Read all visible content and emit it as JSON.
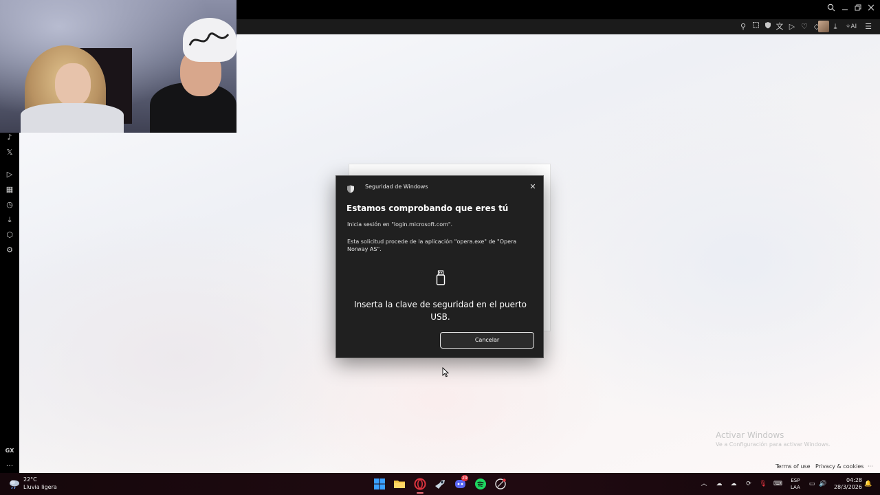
{
  "browser": {
    "ai_label": "AI"
  },
  "sidebar": {
    "gx_label": "GX",
    "more_label": "···"
  },
  "dialog": {
    "app_name": "Seguridad de Windows",
    "close_glyph": "✕",
    "title": "Estamos comprobando que eres tú",
    "signin_line": "Inicia sesión en \"login.microsoft.com\".",
    "request_line": "Esta solicitud procede de la aplicación \"opera.exe\" de \"Opera Norway AS\".",
    "prompt": "Inserta la clave de seguridad en el puerto USB.",
    "cancel_label": "Cancelar"
  },
  "watermark": {
    "title": "Activar Windows",
    "subtitle": "Ve a Configuración para activar Windows."
  },
  "footer": {
    "terms": "Terms of use",
    "privacy": "Privacy & cookies",
    "more": "···"
  },
  "taskbar": {
    "temperature": "22°C",
    "weather": "Lluvia ligera",
    "discord_badge": "29",
    "lang_top": "ESP",
    "lang_bottom": "LAA",
    "time": "04:28",
    "date": "28/3/2026"
  },
  "colors": {
    "dialog_bg": "#202020",
    "taskbar_bg": "#1e0a10",
    "opera_red": "#e0343f",
    "spotify_green": "#1ed760",
    "discord_blurple": "#5865f2"
  }
}
